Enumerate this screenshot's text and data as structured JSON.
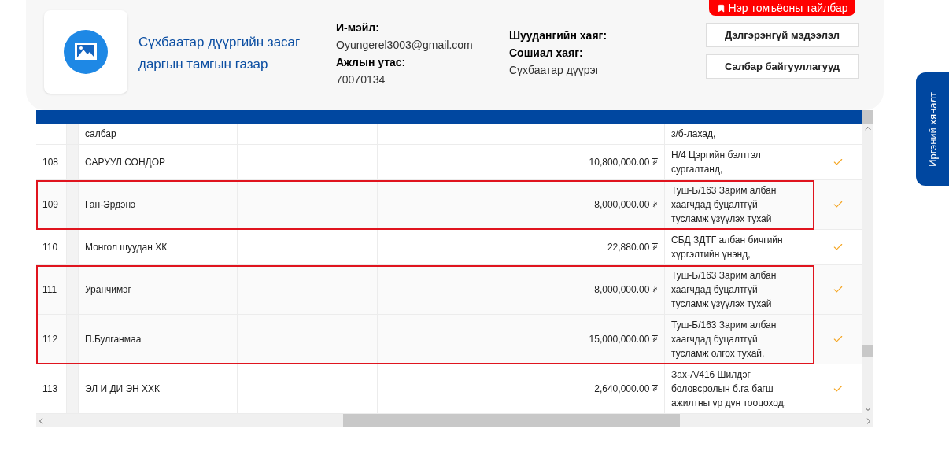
{
  "org_card": {
    "name": "Сүхбаатар дүүргийн засаг даргын тамгын газар",
    "contacts": [
      {
        "label": "И-мэйл:",
        "value": "Oyungerel3003@gmail.com"
      },
      {
        "label": "Ажлын утас:",
        "value": "70070134"
      }
    ],
    "addresses": [
      {
        "label": "Шуудангийн хаяг:"
      },
      {
        "label": "Сошиал хаяг:",
        "value": "Сүхбаатар дүүрэг"
      }
    ],
    "glossary_button": "Нэр томъёоны тайлбар",
    "buttons": [
      "Дэлгэрэнгүй мэдээлэл",
      "Салбар байгууллагууд"
    ]
  },
  "side_tab": "Иргэний хяналт",
  "table": {
    "row_groups": [
      {
        "highlighted": false,
        "rows": [
          {
            "number": "",
            "name": "салбар",
            "amount": "",
            "description": "з/б-лахад,",
            "checked": false
          },
          {
            "number": "108",
            "name": "САРУУЛ СОНДОР",
            "amount": "10,800,000.00 ₮",
            "description": "Н/4 Цэргийн бэлтгэл сургалтанд,",
            "checked": true
          }
        ]
      },
      {
        "highlighted": true,
        "rows": [
          {
            "number": "109",
            "name": "Ган-Эрдэнэ",
            "amount": "8,000,000.00 ₮",
            "description": "Туш-Б/163 Зарим албан хаагчдад буцалтгүй тусламж үзүүлэх тухай",
            "checked": true
          }
        ]
      },
      {
        "highlighted": false,
        "rows": [
          {
            "number": "110",
            "name": "Монгол шуудан ХК",
            "amount": "22,880.00 ₮",
            "description": "СБД ЗДТГ албан бичгийн хүргэлтийн үнэнд,",
            "checked": true
          }
        ]
      },
      {
        "highlighted": true,
        "rows": [
          {
            "number": "111",
            "name": "Уранчимэг",
            "amount": "8,000,000.00 ₮",
            "description": "Туш-Б/163 Зарим албан хаагчдад буцалтгүй тусламж үзүүлэх тухай",
            "checked": true
          },
          {
            "number": "112",
            "name": "П.Булганмаа",
            "amount": "15,000,000.00 ₮",
            "description": "Туш-Б/163 Зарим албан хаагчдад буцалтгүй тусламж олгох тухай,",
            "checked": true
          }
        ]
      },
      {
        "highlighted": false,
        "rows": [
          {
            "number": "113",
            "name": "ЭЛ И ДИ ЭН ХХК",
            "amount": "2,640,000.00 ₮",
            "description": "Зах-А/416 Шилдэг боловсролын б.га багш ажилтны үр дүн тооцоход,",
            "checked": true
          }
        ]
      }
    ]
  }
}
